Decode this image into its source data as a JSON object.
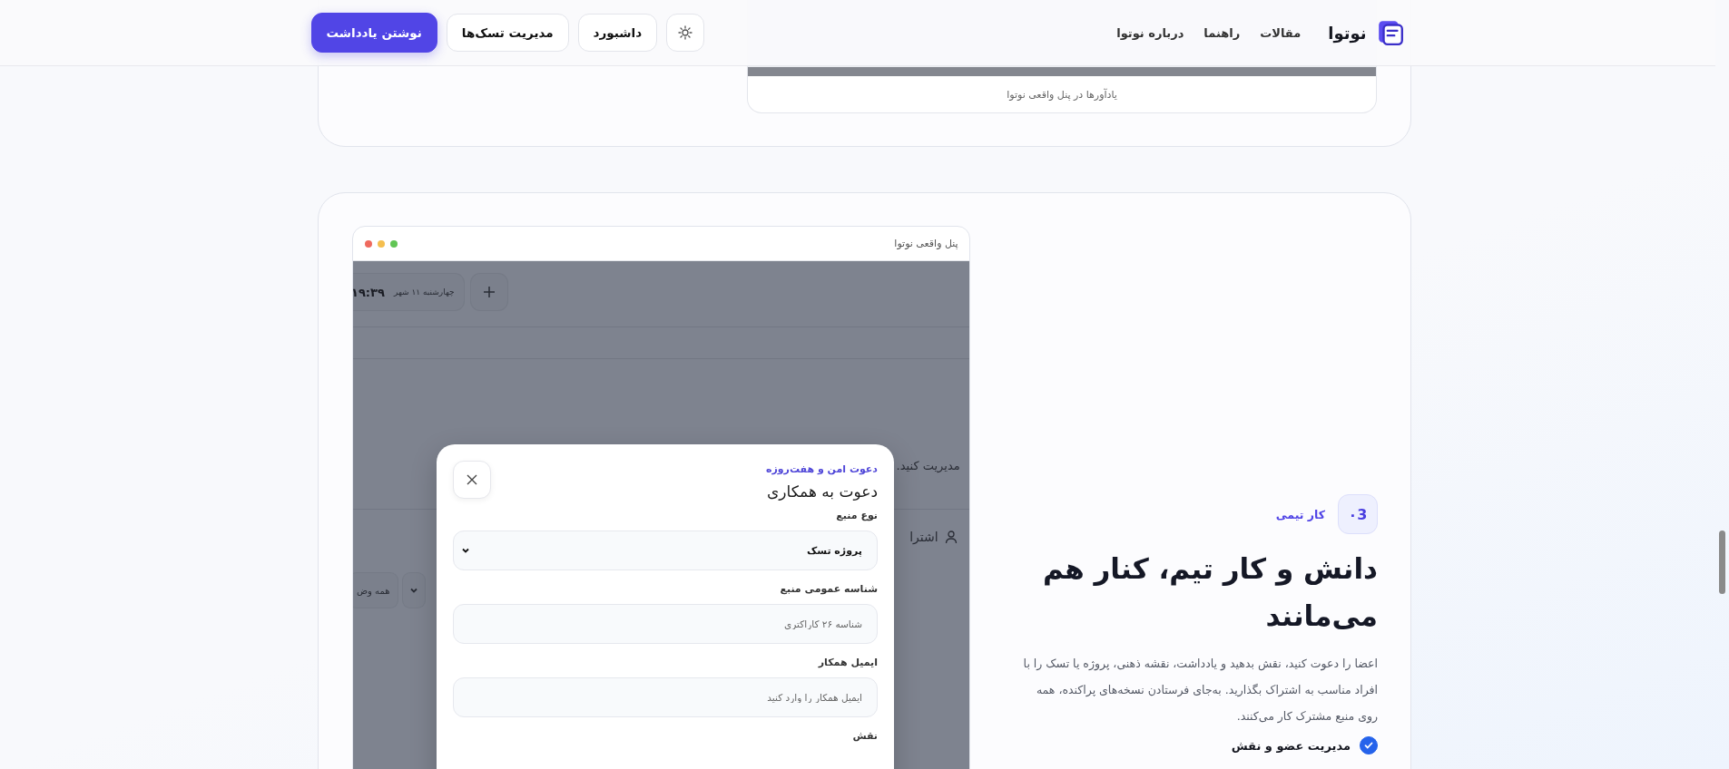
{
  "header": {
    "brand": "نوتوا",
    "nav": [
      {
        "label": "مقالات"
      },
      {
        "label": "راهنما"
      },
      {
        "label": "درباره نوتوا"
      }
    ],
    "buttons": [
      {
        "label": "داشبورد",
        "kind": "secondary"
      },
      {
        "label": "مدیریت تسک‌ها",
        "kind": "secondary"
      },
      {
        "label": "نوشتن یادداشت",
        "kind": "primary"
      }
    ]
  },
  "previous_section": {
    "caption": "یادآورها در پنل واقعی نوتوا"
  },
  "feature": {
    "number": "۰3",
    "tag": "کار تیمی",
    "heading": "دانش و کار تیم، کنار هم می‌مانند",
    "description": "اعضا را دعوت کنید، نقش بدهید و یادداشت، نقشه ذهنی، پروژه یا تسک را با افراد مناسب به اشتراک بگذارید. به‌جای فرستادن نسخه‌های پراکنده، همه روی منبع مشترک کار می‌کنند.",
    "checklist": [
      {
        "label": "مدیریت عضو و نقش",
        "checked": true
      }
    ],
    "preview": {
      "title": "پنل واقعی نوتوا",
      "background": {
        "time": "۱۹:۳۹",
        "date": "چهارشنبه ۱۱ شهر",
        "note": "مدیریت کنید.",
        "tab": "اشترا",
        "filter": "همه وض"
      },
      "dialog": {
        "eyebrow": "دعوت امن و هفت‌روزه",
        "title": "دعوت به همکاری",
        "fields": [
          {
            "kind": "select",
            "label": "نوع منبع",
            "value": "پروژه تسک"
          },
          {
            "kind": "text",
            "label": "شناسه عمومی منبع",
            "placeholder": "شناسه ۲۶ کاراکتری"
          },
          {
            "kind": "text",
            "label": "ایمیل همکار",
            "placeholder": "ایمیل همکار را وارد کنید"
          },
          {
            "kind": "label",
            "label": "نقش"
          }
        ]
      }
    }
  }
}
